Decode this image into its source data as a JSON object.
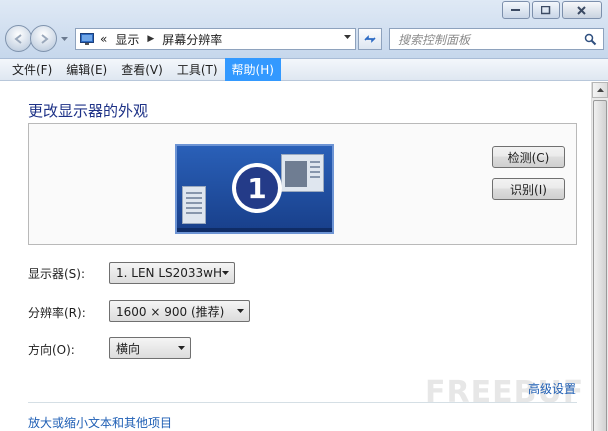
{
  "window": {
    "controls": {
      "minimize": "minimize-icon",
      "maximize": "maximize-icon",
      "close": "close-icon"
    }
  },
  "nav": {
    "breadcrumb_prefix": "«",
    "crumbs": [
      "显示",
      "屏幕分辨率"
    ],
    "search_placeholder": "搜索控制面板"
  },
  "menu": [
    "文件(F)",
    "编辑(E)",
    "查看(V)",
    "工具(T)",
    "帮助(H)"
  ],
  "main": {
    "title": "更改显示器的外观",
    "monitor_number": "1",
    "detect_label": "检测(C)",
    "identify_label": "识别(I)",
    "display_label": "显示器(S):",
    "display_value": "1. LEN LS2033wH",
    "resolution_label": "分辨率(R):",
    "resolution_value": "1600 × 900 (推荐)",
    "orientation_label": "方向(O):",
    "orientation_value": "横向",
    "advanced_link": "高级设置",
    "text_size_link": "放大或缩小文本和其他项目"
  },
  "watermark": "FREEBUF",
  "colors": {
    "accent": "#3399ff",
    "title": "#1e3287",
    "link": "#1f5fb5",
    "monitor": "#2a60b8"
  }
}
